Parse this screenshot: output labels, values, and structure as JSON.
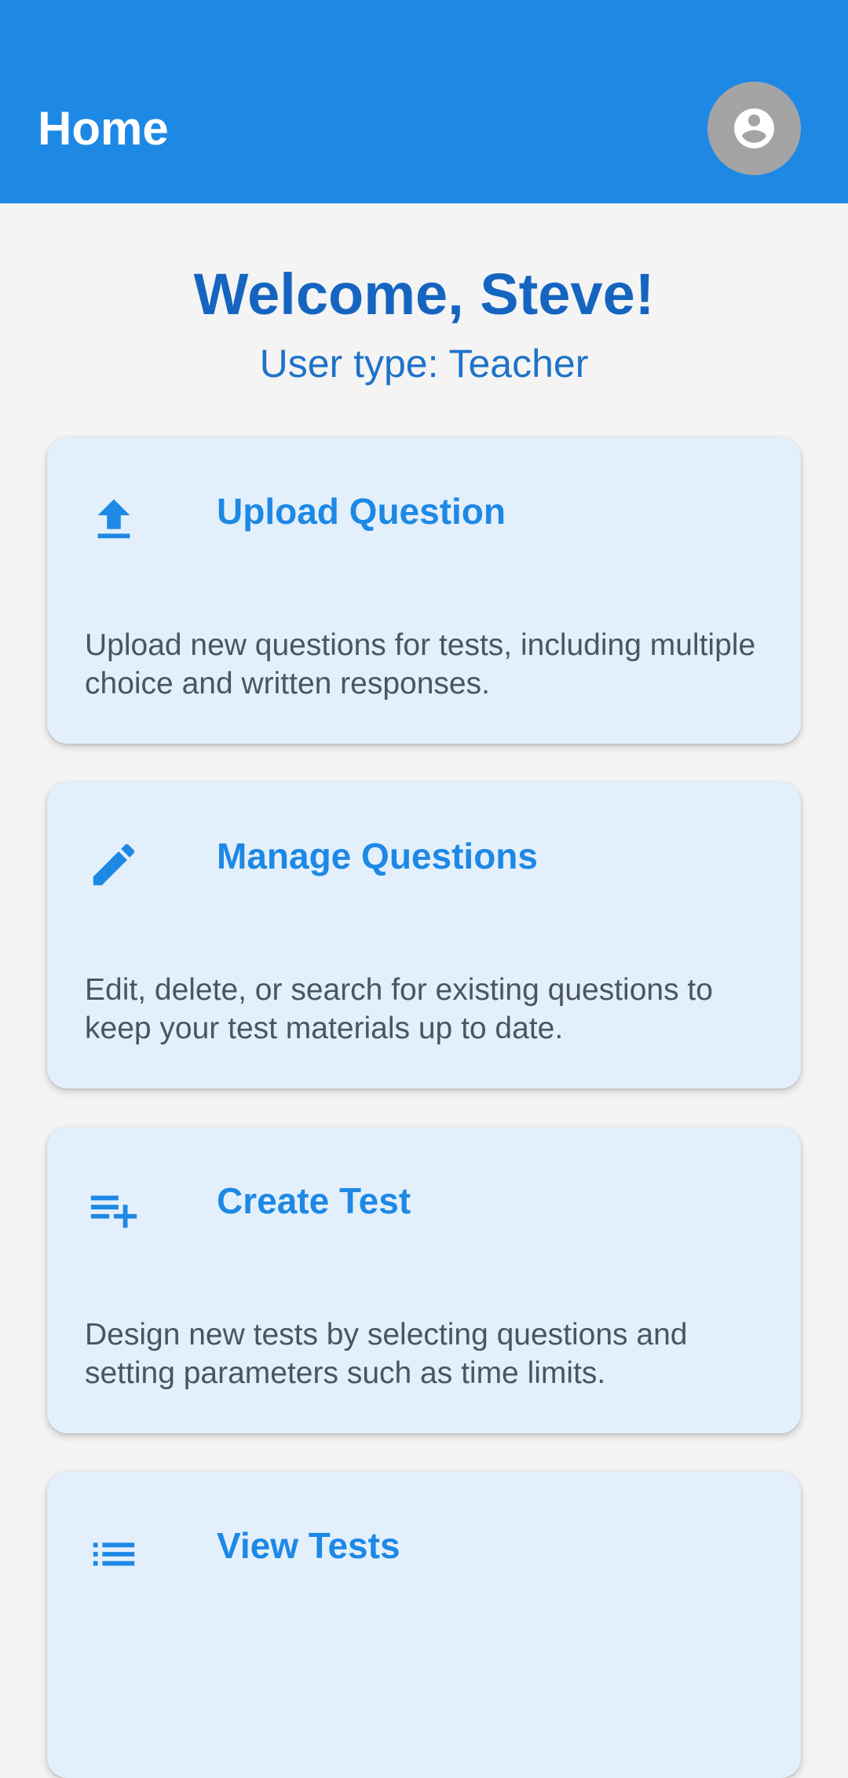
{
  "appbar": {
    "title": "Home",
    "avatar_icon": "account-circle-icon"
  },
  "welcome": {
    "greeting": "Welcome, Steve!",
    "user_type": "User type: Teacher"
  },
  "cards": [
    {
      "icon": "upload-icon",
      "title": "Upload Question",
      "description": "Upload new questions for tests, including multiple choice and written responses."
    },
    {
      "icon": "pencil-icon",
      "title": "Manage Questions",
      "description": "Edit, delete, or search for existing questions to keep your test materials up to date."
    },
    {
      "icon": "playlist-add-icon",
      "title": "Create Test",
      "description": "Design new tests by selecting questions and setting parameters such as time limits."
    },
    {
      "icon": "list-icon",
      "title": "View Tests",
      "description": ""
    }
  ],
  "colors": {
    "primary": "#1e88e5",
    "heading": "#1565c0",
    "card_background": "#e3f0fb",
    "page_background": "#f4f4f4"
  }
}
